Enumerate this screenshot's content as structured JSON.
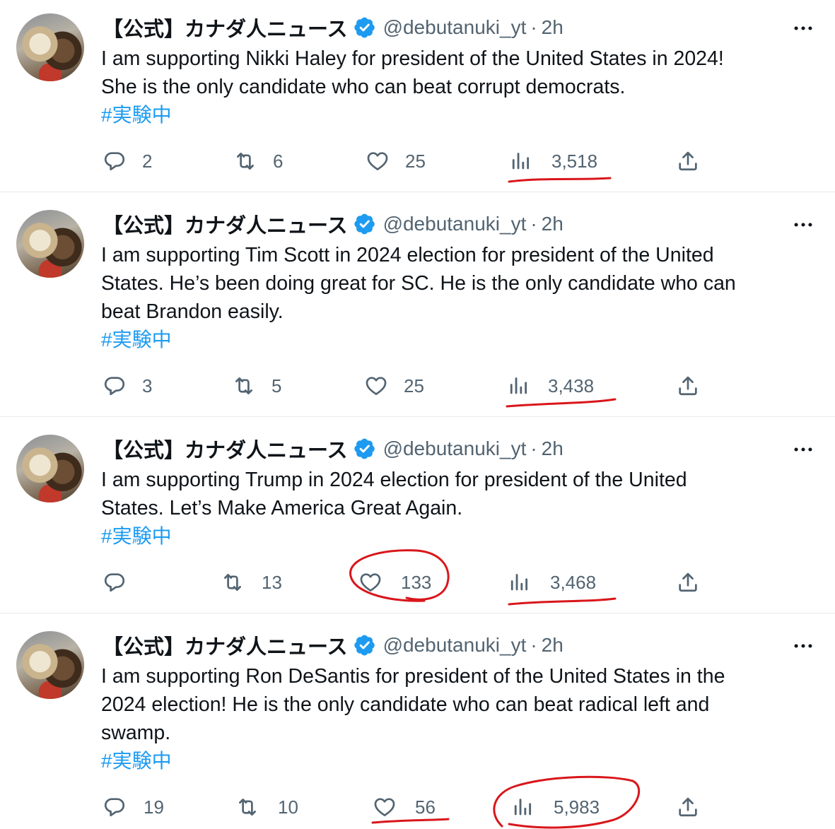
{
  "colors": {
    "accent": "#1d9bf0",
    "annotation": "#d9161b",
    "muted": "#536471"
  },
  "author": {
    "name": "【公式】カナダ人ニュース",
    "handle": "@debutanuki_yt",
    "separator": "·",
    "time": "2h"
  },
  "tweets": [
    {
      "text": "I am supporting Nikki Haley for president of the United States in 2024!\nShe is the only candidate who can beat corrupt democrats.",
      "hashtag": "#実験中",
      "replies": "2",
      "retweets": "6",
      "likes": "25",
      "views": "3,518"
    },
    {
      "text": "I am supporting Tim Scott in 2024 election for president of the United\nStates. He’s been doing great for SC. He is the only candidate who can\nbeat Brandon easily.",
      "hashtag": "#実験中",
      "replies": "3",
      "retweets": "5",
      "likes": "25",
      "views": "3,438"
    },
    {
      "text": "I am supporting Trump in 2024 election for president of the United\nStates. Let’s Make America Great Again.",
      "hashtag": "#実験中",
      "replies": "",
      "retweets": "13",
      "likes": "133",
      "views": "3,468"
    },
    {
      "text": "I am supporting Ron DeSantis for president of the United States in the\n2024 election! He is the only candidate who can beat radical left and\nswamp.",
      "hashtag": "#実験中",
      "replies": "19",
      "retweets": "10",
      "likes": "56",
      "views": "5,983"
    }
  ],
  "icons": {
    "reply": "reply-icon",
    "retweet": "retweet-icon",
    "like": "heart-icon",
    "views": "views-chart-icon",
    "share": "share-icon",
    "more": "more-dots-icon",
    "verified": "verified-badge-icon"
  }
}
